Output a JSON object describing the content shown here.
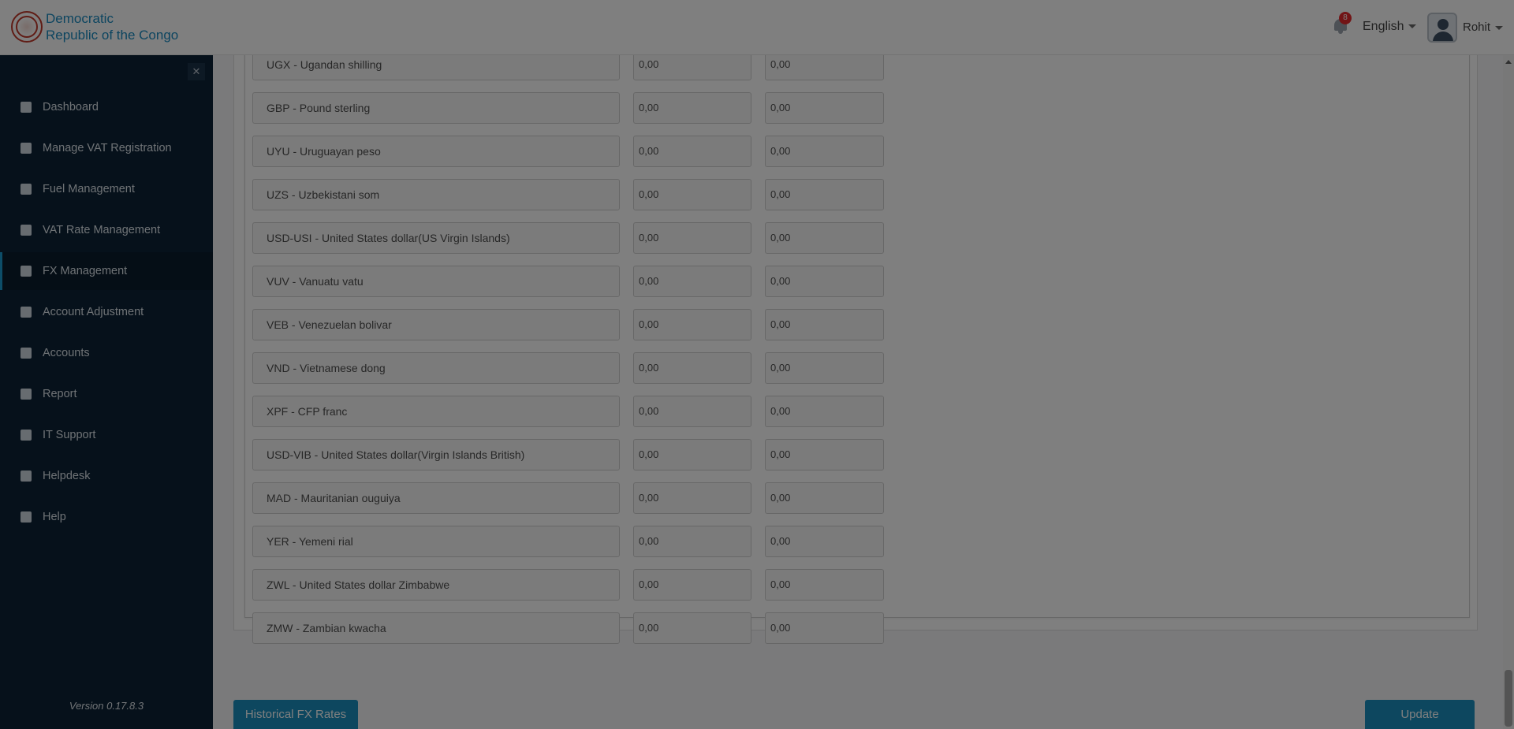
{
  "header": {
    "brand_line1": "Democratic",
    "brand_line2": "Republic of the Congo",
    "notification_count": "8",
    "language": "English",
    "user_name": "Rohit"
  },
  "sidebar": {
    "items": [
      {
        "label": "Dashboard",
        "icon": "dashboard-icon"
      },
      {
        "label": "Manage VAT Registration",
        "icon": "registration-icon"
      },
      {
        "label": "Fuel Management",
        "icon": "fuel-pump-icon"
      },
      {
        "label": "VAT Rate Management",
        "icon": "bar-chart-icon"
      },
      {
        "label": "FX Management",
        "icon": "exchange-icon",
        "active": true
      },
      {
        "label": "Account Adjustment",
        "icon": "document-icon"
      },
      {
        "label": "Accounts",
        "icon": "ledger-icon"
      },
      {
        "label": "Report",
        "icon": "report-icon"
      },
      {
        "label": "IT Support",
        "icon": "support-person-icon"
      },
      {
        "label": "Helpdesk",
        "icon": "helpdesk-icon"
      },
      {
        "label": "Help",
        "icon": "question-icon"
      }
    ],
    "version": "Version 0.17.8.3"
  },
  "fx_rates": [
    {
      "currency": "UGX - Ugandan shilling",
      "rate1": "0,00",
      "rate2": "0,00"
    },
    {
      "currency": "GBP - Pound sterling",
      "rate1": "0,00",
      "rate2": "0,00"
    },
    {
      "currency": "UYU - Uruguayan peso",
      "rate1": "0,00",
      "rate2": "0,00"
    },
    {
      "currency": "UZS - Uzbekistani som",
      "rate1": "0,00",
      "rate2": "0,00"
    },
    {
      "currency": "USD-USI - United States dollar(US Virgin Islands)",
      "rate1": "0,00",
      "rate2": "0,00"
    },
    {
      "currency": "VUV - Vanuatu vatu",
      "rate1": "0,00",
      "rate2": "0,00"
    },
    {
      "currency": "VEB - Venezuelan bolivar",
      "rate1": "0,00",
      "rate2": "0,00"
    },
    {
      "currency": "VND - Vietnamese dong",
      "rate1": "0,00",
      "rate2": "0,00"
    },
    {
      "currency": "XPF - CFP franc",
      "rate1": "0,00",
      "rate2": "0,00"
    },
    {
      "currency": "USD-VIB - United States dollar(Virgin Islands British)",
      "rate1": "0,00",
      "rate2": "0,00"
    },
    {
      "currency": "MAD - Mauritanian ouguiya",
      "rate1": "0,00",
      "rate2": "0,00"
    },
    {
      "currency": "YER - Yemeni rial",
      "rate1": "0,00",
      "rate2": "0,00"
    },
    {
      "currency": "ZWL - United States dollar Zimbabwe",
      "rate1": "0,00",
      "rate2": "0,00"
    },
    {
      "currency": "ZMW - Zambian kwacha",
      "rate1": "0,00",
      "rate2": "0,00"
    }
  ],
  "actions": {
    "historical_label": "Historical FX Rates",
    "update_label": "Update"
  },
  "colors": {
    "accent": "#1a8fbf",
    "sidebar_bg": "#0c2236",
    "badge": "#e4292c"
  }
}
